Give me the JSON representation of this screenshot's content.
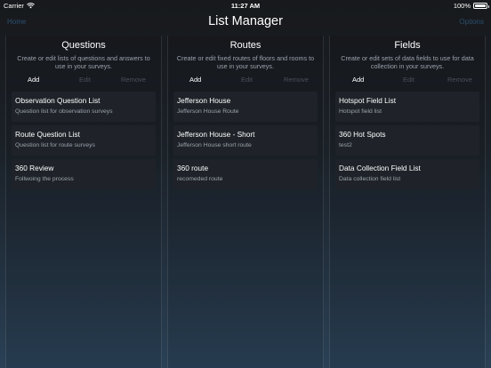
{
  "status": {
    "carrier": "Carrier",
    "time": "11:27 AM",
    "battery": "100%",
    "battery_level": 1.0
  },
  "nav": {
    "left": "Home",
    "title": "List Manager",
    "right": "Options"
  },
  "actions": {
    "add": "Add",
    "edit": "Edit",
    "remove": "Remove"
  },
  "panels": [
    {
      "title": "Questions",
      "description": "Create or edit lists of questions and answers to use in your surveys.",
      "items": [
        {
          "title": "Observation Question List",
          "subtitle": "Question list for observation surveys"
        },
        {
          "title": "Route Question List",
          "subtitle": "Question list for route surveys"
        },
        {
          "title": "360 Review",
          "subtitle": "Follwoing the process"
        }
      ]
    },
    {
      "title": "Routes",
      "description": "Create or edit fixed routes of floors and rooms to use in your surveys.",
      "items": [
        {
          "title": "Jefferson House",
          "subtitle": "Jefferson House Route"
        },
        {
          "title": "Jefferson House - Short",
          "subtitle": "Jefferson House short route"
        },
        {
          "title": "360 route",
          "subtitle": "recomeded route"
        }
      ]
    },
    {
      "title": "Fields",
      "description": "Create or edit sets of data fields to use for data collection in your surveys.",
      "items": [
        {
          "title": "Hotspot Field List",
          "subtitle": "Hotspot field list"
        },
        {
          "title": "360 Hot Spots",
          "subtitle": "test2"
        },
        {
          "title": "Data Collection Field List",
          "subtitle": "Data collection field list"
        }
      ]
    }
  ]
}
